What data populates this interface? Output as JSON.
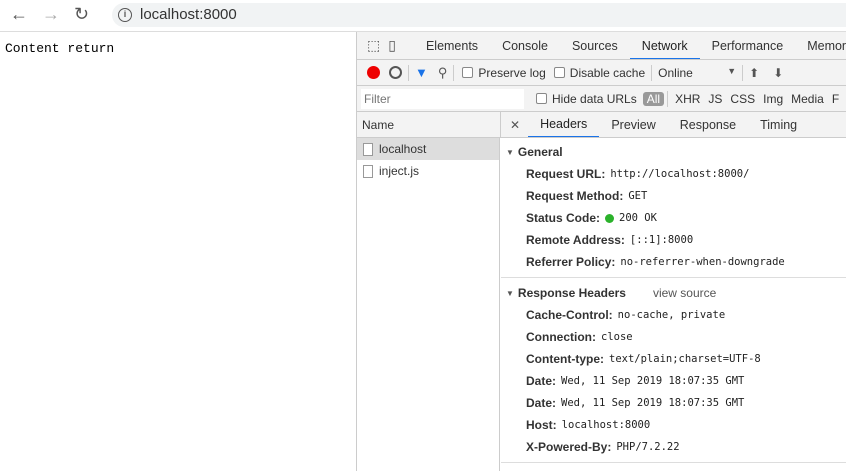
{
  "browser": {
    "url": "localhost:8000"
  },
  "page": {
    "content": "Content return"
  },
  "devtools": {
    "tabs": [
      "Elements",
      "Console",
      "Sources",
      "Network",
      "Performance",
      "Memor"
    ],
    "toolbar": {
      "preserve_log": "Preserve log",
      "disable_cache": "Disable cache",
      "throttle": "Online"
    },
    "filter": {
      "placeholder": "Filter",
      "hide_data_urls": "Hide data URLs",
      "types": [
        "All",
        "XHR",
        "JS",
        "CSS",
        "Img",
        "Media",
        "F"
      ]
    },
    "name_header": "Name",
    "requests": [
      "localhost",
      "inject.js"
    ],
    "detail_tabs": [
      "Headers",
      "Preview",
      "Response",
      "Timing"
    ],
    "general": {
      "title": "General",
      "rows": [
        {
          "k": "Request URL:",
          "v": "http://localhost:8000/"
        },
        {
          "k": "Request Method:",
          "v": "GET"
        },
        {
          "k": "Status Code:",
          "v": "200 OK"
        },
        {
          "k": "Remote Address:",
          "v": "[::1]:8000"
        },
        {
          "k": "Referrer Policy:",
          "v": "no-referrer-when-downgrade"
        }
      ]
    },
    "response": {
      "title": "Response Headers",
      "view_source": "view source",
      "rows": [
        {
          "k": "Cache-Control:",
          "v": "no-cache, private"
        },
        {
          "k": "Connection:",
          "v": "close"
        },
        {
          "k": "Content-type:",
          "v": "text/plain;charset=UTF-8"
        },
        {
          "k": "Date:",
          "v": "Wed, 11 Sep 2019 18:07:35 GMT"
        },
        {
          "k": "Date:",
          "v": "Wed, 11 Sep 2019 18:07:35 GMT"
        },
        {
          "k": "Host:",
          "v": "localhost:8000"
        },
        {
          "k": "X-Powered-By:",
          "v": "PHP/7.2.22"
        }
      ]
    }
  }
}
